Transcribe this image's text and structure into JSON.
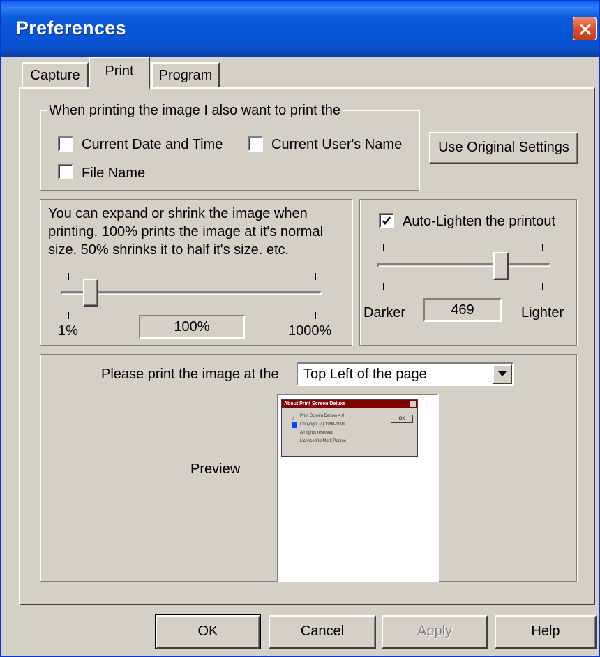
{
  "window": {
    "title": "Preferences"
  },
  "tabs": [
    {
      "label": "Capture",
      "active": false
    },
    {
      "label": "Print",
      "active": true
    },
    {
      "label": "Program",
      "active": false
    }
  ],
  "print_extras": {
    "legend": "When printing the image I also want to print the",
    "current_date_time": {
      "label": "Current Date and Time",
      "checked": false
    },
    "current_user": {
      "label": "Current User's Name",
      "checked": false
    },
    "file_name": {
      "label": "File Name",
      "checked": false
    }
  },
  "use_original_settings_label": "Use Original Settings",
  "scale": {
    "description_line1": "You can expand or shrink the image when",
    "description_line2": "printing.  100% prints the image at it's normal",
    "description_line3": "size.  50% shrinks it to half it's size. etc.",
    "min_label": "1%",
    "max_label": "1000%",
    "value_text": "100%",
    "value": 100,
    "min": 1,
    "max": 1000
  },
  "lighten": {
    "checkbox_label": "Auto-Lighten the printout",
    "checked": true,
    "darker_label": "Darker",
    "lighter_label": "Lighter",
    "value_text": "469"
  },
  "position": {
    "label": "Please print the image at the",
    "selected": "Top Left of the page"
  },
  "preview": {
    "label": "Preview",
    "mini_title": "About Print Screen Deluxe",
    "mini_lines": [
      "Print Screen Deluxe 4.0",
      "Copyright (c) 1998-1999",
      "All rights reserved",
      "Licensed to Mark Pearce"
    ],
    "mini_ok": "OK"
  },
  "buttons": {
    "ok": "OK",
    "cancel": "Cancel",
    "apply": "Apply",
    "help": "Help"
  },
  "colors": {
    "titlebar": "#0753d6",
    "face": "#d4d0c8",
    "close": "#e0522e"
  }
}
